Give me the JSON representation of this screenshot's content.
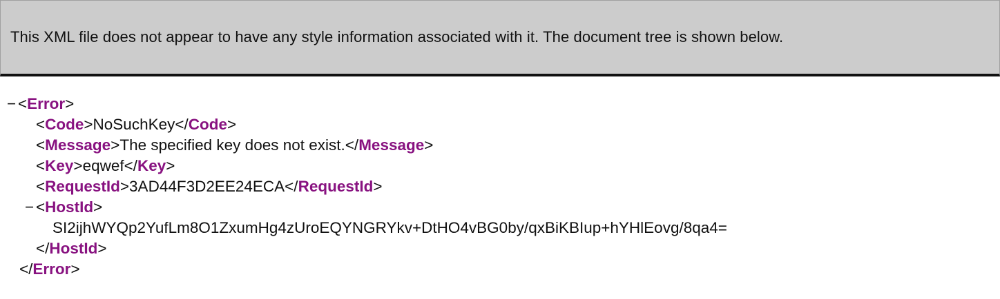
{
  "info_bar": {
    "message": "This XML file does not appear to have any style information associated with it. The document tree is shown below."
  },
  "tree": {
    "collapse_glyph": "−",
    "root_tag": "Error",
    "code": {
      "tag": "Code",
      "value": "NoSuchKey"
    },
    "message": {
      "tag": "Message",
      "value": "The specified key does not exist."
    },
    "key": {
      "tag": "Key",
      "value": "eqwef"
    },
    "request_id": {
      "tag": "RequestId",
      "value": "3AD44F3D2EE24ECA"
    },
    "host_id": {
      "tag": "HostId",
      "value": "SI2ijhWYQp2YufLm8O1ZxumHg4zUroEQYNGRYkv+DtHO4vBG0by/qxBiKBIup+hYHlEovg/8qa4="
    }
  },
  "colors": {
    "tag_name": "#881280",
    "info_bar_bg": "#cccccc"
  }
}
